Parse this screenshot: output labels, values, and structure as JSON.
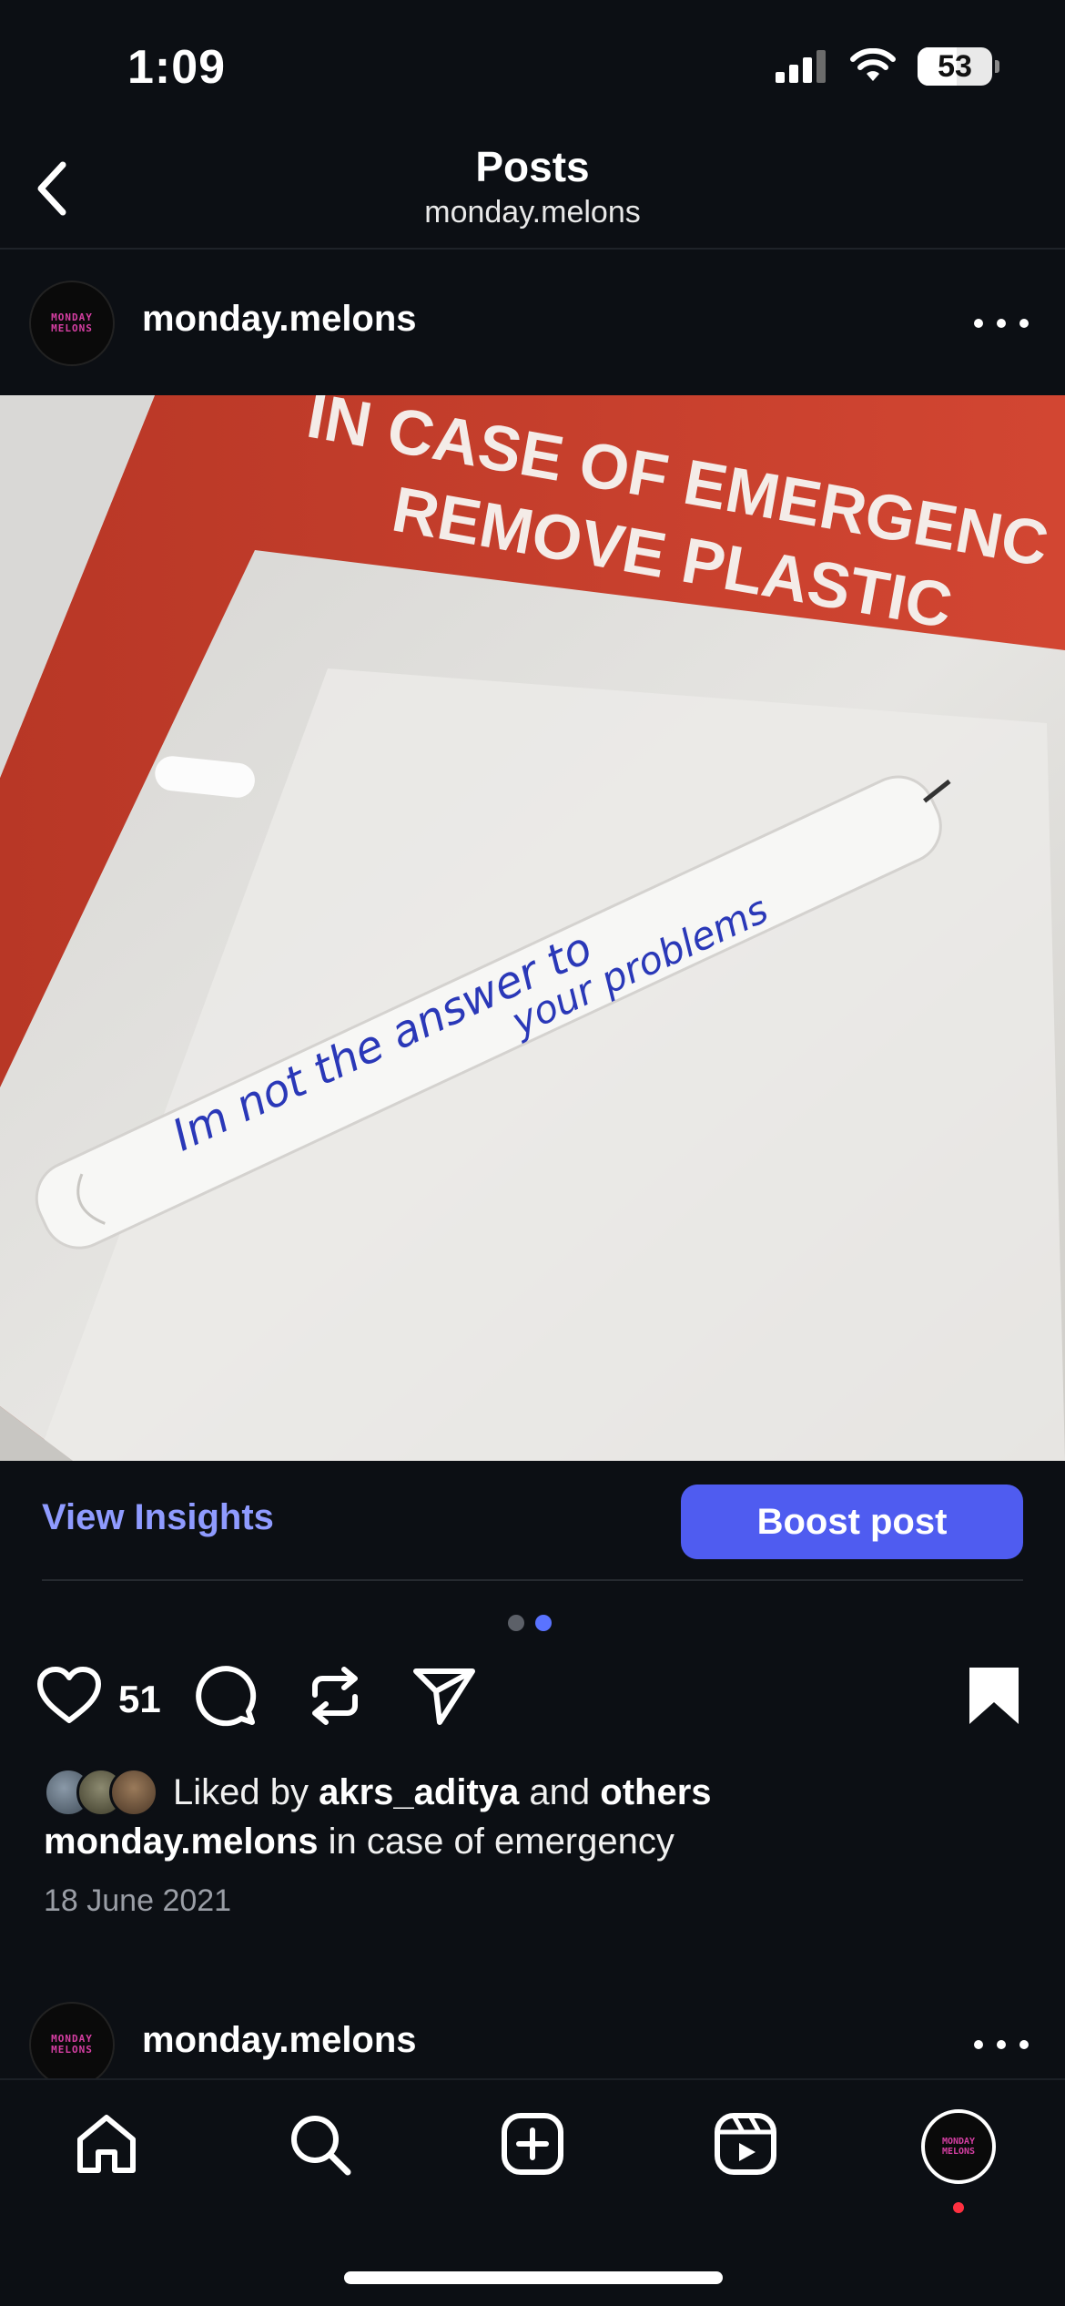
{
  "status_bar": {
    "time": "1:09",
    "battery": "53",
    "battery_level": 0.53
  },
  "header": {
    "title": "Posts",
    "subtitle": "monday.melons"
  },
  "post": {
    "avatar_text": [
      "MONDAY",
      "MELONS"
    ],
    "username": "monday.melons",
    "image": {
      "sign_line1": "IN CASE OF EMERGENC",
      "sign_line2": "REMOVE PLASTIC",
      "note_line1": "Im  not the answer  to",
      "note_line2": "your problems"
    },
    "insights_label": "View Insights",
    "boost_label": "Boost post",
    "carousel": {
      "count": 2,
      "active_index": 1
    },
    "like_count": "51",
    "liked_by_prefix": "Liked by",
    "liked_by_user": "akrs_aditya",
    "liked_by_and": "and",
    "liked_by_others": "others",
    "caption_user": "monday.melons",
    "caption_text": "in case of emergency",
    "date": "18 June 2021"
  },
  "next_post": {
    "username": "monday.melons"
  },
  "tab_bar": {
    "items": [
      "home-icon",
      "search-icon",
      "create-icon",
      "reels-icon",
      "profile-avatar"
    ]
  },
  "colors": {
    "accent": "#4f5cf0",
    "link": "#8f9bff",
    "background": "#0c0f14",
    "sign_red": "#c9402f"
  }
}
